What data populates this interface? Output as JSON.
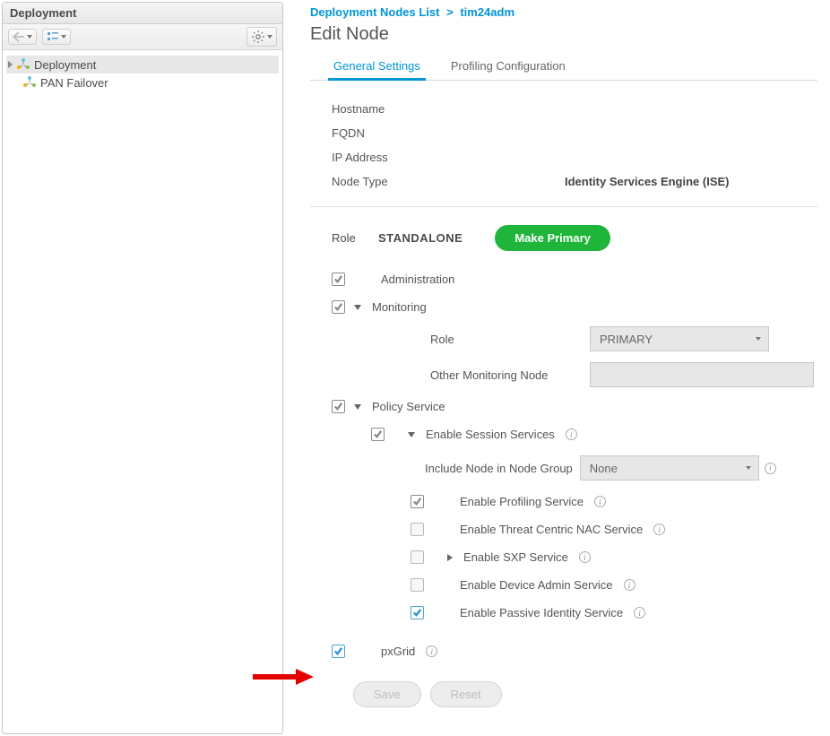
{
  "sidebar": {
    "title": "Deployment",
    "tree": [
      {
        "label": "Deployment",
        "selected": true,
        "expandable": true
      },
      {
        "label": "PAN Failover",
        "selected": false,
        "expandable": false
      }
    ]
  },
  "breadcrumb": {
    "root": "Deployment Nodes List",
    "current": "tim24adm"
  },
  "page_title": "Edit Node",
  "tabs": {
    "general": "General Settings",
    "profiling": "Profiling Configuration"
  },
  "fields": {
    "hostname_label": "Hostname",
    "hostname_value": "",
    "fqdn_label": "FQDN",
    "fqdn_value": "",
    "ip_label": "IP Address",
    "ip_value": "",
    "nodetype_label": "Node Type",
    "nodetype_value": "Identity Services Engine (ISE)"
  },
  "role": {
    "label": "Role",
    "value": "STANDALONE",
    "primary_button": "Make Primary"
  },
  "options": {
    "administration": "Administration",
    "monitoring": "Monitoring",
    "monitoring_role_label": "Role",
    "monitoring_role_value": "PRIMARY",
    "other_monitoring_label": "Other Monitoring Node",
    "policy_service": "Policy Service",
    "enable_session": "Enable Session Services",
    "include_node_label": "Include Node in Node Group",
    "include_node_value": "None",
    "enable_profiling": "Enable Profiling Service",
    "enable_tcnac": "Enable Threat Centric NAC Service",
    "enable_sxp": "Enable SXP Service",
    "enable_device_admin": "Enable Device Admin Service",
    "enable_passive_id": "Enable Passive Identity Service",
    "pxgrid": "pxGrid"
  },
  "buttons": {
    "save": "Save",
    "reset": "Reset"
  }
}
